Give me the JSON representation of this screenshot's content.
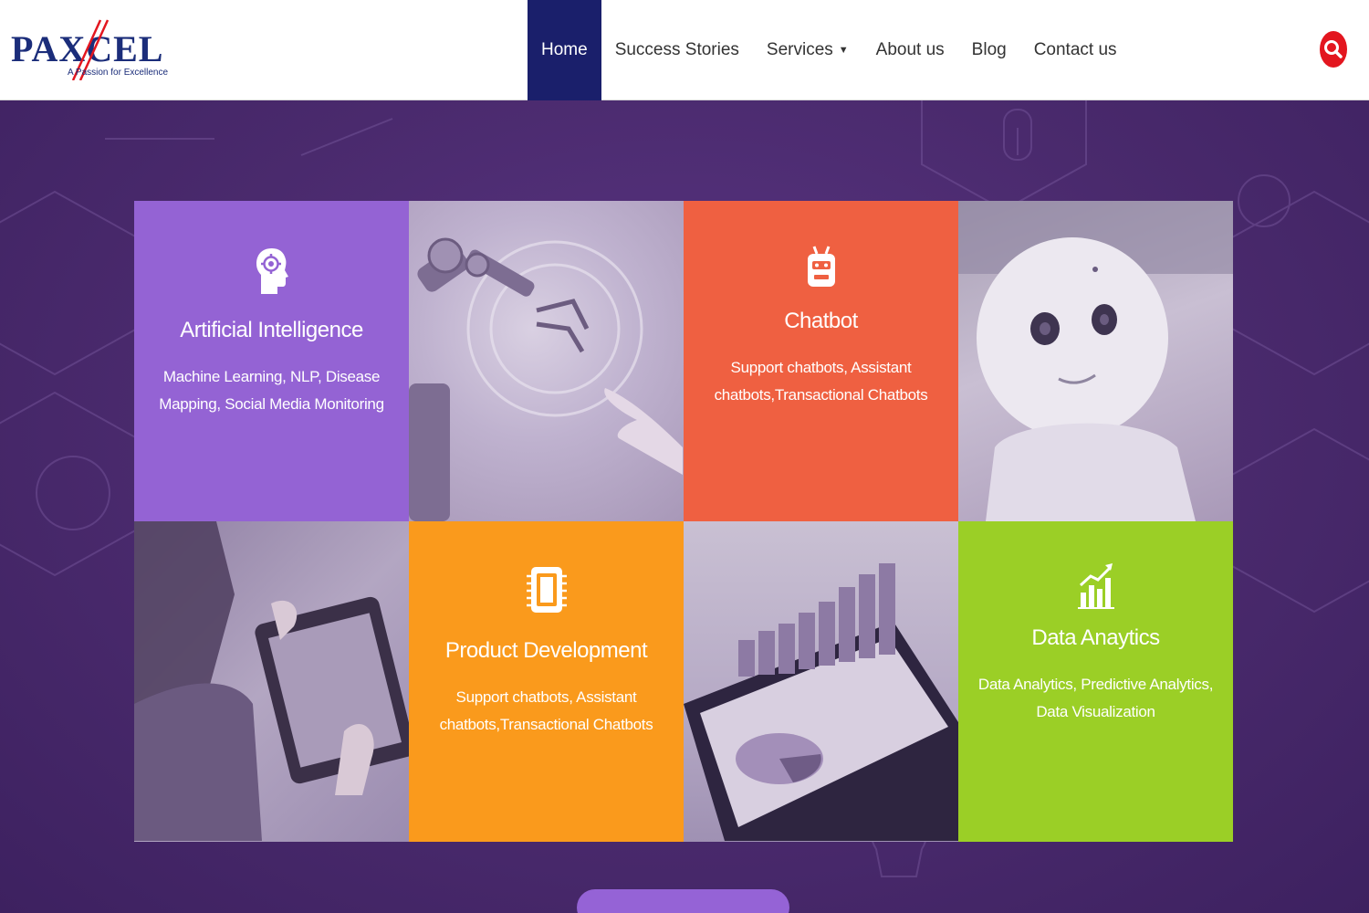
{
  "brand": {
    "name": "PAXCEL",
    "tagline": "A Passion for Excellence",
    "primary_color": "#1b2d7a",
    "accent_color": "#e3161f"
  },
  "nav": {
    "items": [
      {
        "label": "Home",
        "active": true
      },
      {
        "label": "Success Stories",
        "active": false
      },
      {
        "label": "Services",
        "active": false,
        "has_dropdown": true
      },
      {
        "label": "About us",
        "active": false
      },
      {
        "label": "Blog",
        "active": false
      },
      {
        "label": "Contact us",
        "active": false
      }
    ],
    "active_color": "#1a1f6b"
  },
  "search": {
    "icon": "search-icon"
  },
  "tiles": [
    {
      "title": "Artificial Intelligence",
      "desc": "Machine Learning, NLP, Disease Mapping, Social Media Monitoring",
      "icon": "brain-gear-icon",
      "color": "#9463d4"
    },
    {
      "photo": "robot-arm-image"
    },
    {
      "title": "Chatbot",
      "desc": "Support chatbots, Assistant chatbots,Transactional Chatbots",
      "icon": "robot-head-icon",
      "color": "#ef6041"
    },
    {
      "photo": "humanoid-robot-image"
    },
    {
      "photo": "person-tablet-image"
    },
    {
      "title": "Product Development",
      "desc": "Support chatbots, Assistant chatbots,Transactional Chatbots",
      "icon": "chip-icon",
      "color": "#fa9a1c"
    },
    {
      "photo": "bar-chart-tablet-image"
    },
    {
      "title": "Data Anaytics",
      "desc": "Data Analytics, Predictive Analytics, Data Visualization",
      "icon": "bar-chart-icon",
      "color": "#9bcf26"
    }
  ],
  "background_color": "#4a2a6b",
  "cta_color": "#9563d6"
}
